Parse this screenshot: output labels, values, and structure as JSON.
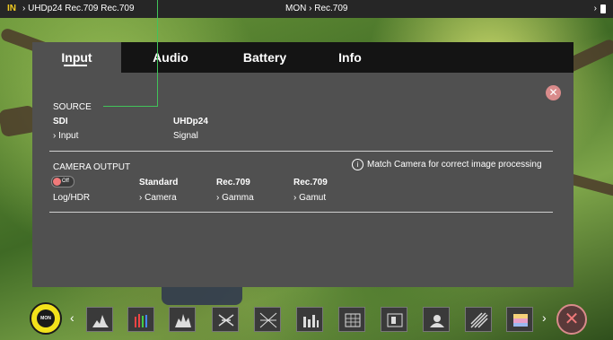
{
  "topbar": {
    "in_label": "IN",
    "left_text": "› UHDp24 Rec.709 Rec.709",
    "mid_text": "MON  › Rec.709",
    "right_text": "›"
  },
  "tabs": [
    "Input",
    "Audio",
    "Battery",
    "Info"
  ],
  "active_tab": "Input",
  "source": {
    "heading": "SOURCE",
    "input_value": "SDI",
    "input_label": "› Input",
    "signal_value": "UHDp24",
    "signal_label": "Signal"
  },
  "camera_output": {
    "heading": "CAMERA OUTPUT",
    "toggle_state": "Off",
    "log_hdr_label": "Log/HDR",
    "camera_value": "Standard",
    "camera_label": "› Camera",
    "gamma_value": "Rec.709",
    "gamma_label": "› Gamma",
    "gamut_value": "Rec.709",
    "gamut_label": "› Gamut",
    "info_text": "Match Camera for correct image processing"
  },
  "toolbar": {
    "mon_label": "MON",
    "tools": [
      "waveform-tool",
      "rgb-parade-tool",
      "vectorscope-tool",
      "focus-peaking-tool",
      "zebra-tool",
      "histogram-tool",
      "guides-tool",
      "frame-lines-tool",
      "false-color-tool",
      "zoom-tool",
      "lut-tool"
    ]
  },
  "colors": {
    "accent_yellow": "#f2e21b",
    "close_red": "#d98b8b",
    "callout_green": "#41c35a",
    "panel_bg": "#505050",
    "tabbar_bg": "#141414"
  }
}
